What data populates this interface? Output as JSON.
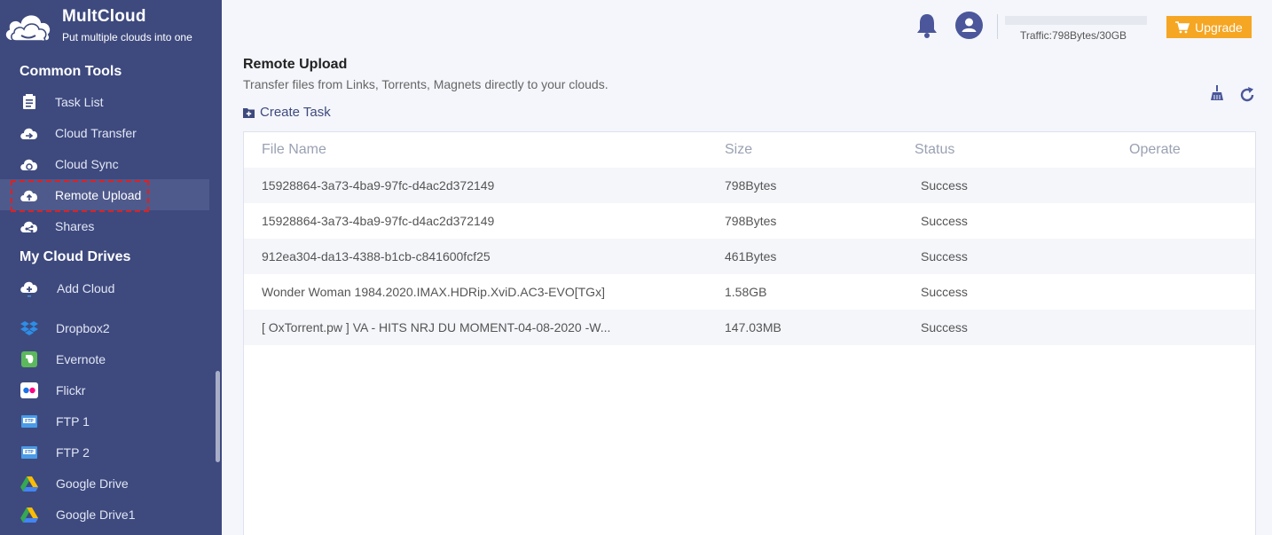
{
  "brand": {
    "name": "MultCloud",
    "tagline": "Put multiple clouds into one"
  },
  "sidebar": {
    "common_tools_title": "Common Tools",
    "common_tools": [
      {
        "label": "Task List",
        "icon": "task-list-icon"
      },
      {
        "label": "Cloud Transfer",
        "icon": "cloud-transfer-icon"
      },
      {
        "label": "Cloud Sync",
        "icon": "cloud-sync-icon"
      },
      {
        "label": "Remote Upload",
        "icon": "cloud-upload-icon",
        "active": true
      },
      {
        "label": "Shares",
        "icon": "cloud-share-icon"
      }
    ],
    "drives_title": "My Cloud Drives",
    "drives": [
      {
        "label": "Add Cloud",
        "icon": "add-cloud-icon"
      },
      {
        "label": "Dropbox2",
        "icon": "dropbox-icon"
      },
      {
        "label": "Evernote",
        "icon": "evernote-icon"
      },
      {
        "label": "Flickr",
        "icon": "flickr-icon"
      },
      {
        "label": "FTP 1",
        "icon": "ftp-icon"
      },
      {
        "label": "FTP 2",
        "icon": "ftp-icon"
      },
      {
        "label": "Google Drive",
        "icon": "google-drive-icon"
      },
      {
        "label": "Google Drive1",
        "icon": "google-drive-icon"
      }
    ]
  },
  "header": {
    "traffic": "Traffic:798Bytes/30GB",
    "upgrade_label": "Upgrade"
  },
  "page": {
    "title": "Remote Upload",
    "subtitle": "Transfer files from Links, Torrents, Magnets directly to your clouds.",
    "create_task_label": "Create Task"
  },
  "table": {
    "columns": [
      "File Name",
      "Size",
      "Status",
      "Operate"
    ],
    "rows": [
      {
        "name": "15928864-3a73-4ba9-97fc-d4ac2d372149",
        "size": "798Bytes",
        "status": "Success"
      },
      {
        "name": "15928864-3a73-4ba9-97fc-d4ac2d372149",
        "size": "798Bytes",
        "status": "Success"
      },
      {
        "name": "912ea304-da13-4388-b1cb-c841600fcf25",
        "size": "461Bytes",
        "status": "Success"
      },
      {
        "name": "Wonder Woman 1984.2020.IMAX.HDRip.XviD.AC3-EVO[TGx]",
        "size": "1.58GB",
        "status": "Success"
      },
      {
        "name": "[ OxTorrent.pw ] VA - HITS NRJ DU MOMENT-04-08-2020 -W...",
        "size": "147.03MB",
        "status": "Success"
      }
    ]
  },
  "colors": {
    "sidebar_bg": "#3e4a7e",
    "accent": "#3e4a7e",
    "upgrade": "#f5a623",
    "highlight": "#e02020"
  }
}
